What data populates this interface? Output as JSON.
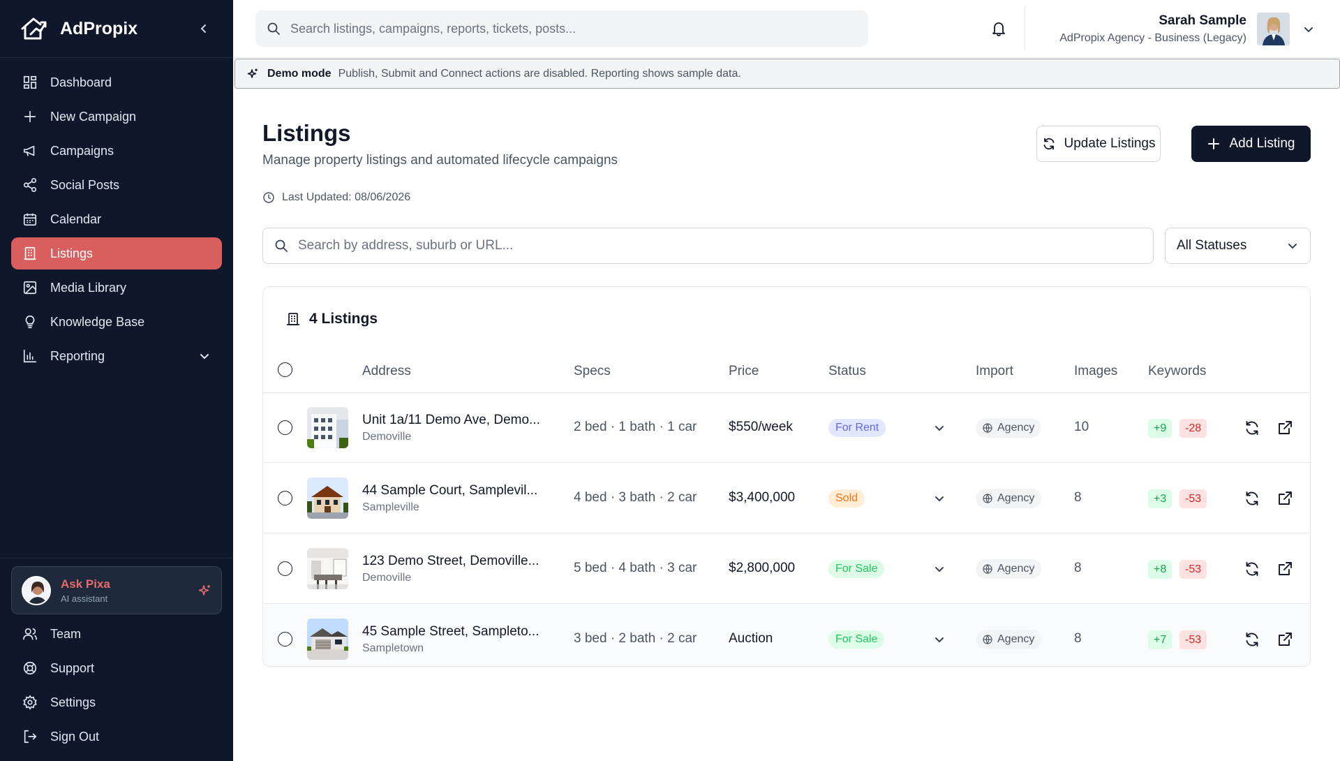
{
  "brand": {
    "name": "AdPropix"
  },
  "sidebar": {
    "items": [
      {
        "label": "Dashboard",
        "icon": "dashboard-icon"
      },
      {
        "label": "New Campaign",
        "icon": "plus-icon"
      },
      {
        "label": "Campaigns",
        "icon": "megaphone-icon"
      },
      {
        "label": "Social Posts",
        "icon": "share-icon"
      },
      {
        "label": "Calendar",
        "icon": "calendar-icon"
      },
      {
        "label": "Listings",
        "icon": "building-icon",
        "active": true
      },
      {
        "label": "Media Library",
        "icon": "image-icon"
      },
      {
        "label": "Knowledge Base",
        "icon": "lightbulb-icon"
      },
      {
        "label": "Reporting",
        "icon": "bar-chart-icon"
      }
    ],
    "assistant": {
      "title": "Ask Pixa",
      "subtitle": "AI assistant"
    },
    "bottom_items": [
      {
        "label": "Team",
        "icon": "users-icon"
      },
      {
        "label": "Support",
        "icon": "lifebuoy-icon"
      },
      {
        "label": "Settings",
        "icon": "gear-icon"
      },
      {
        "label": "Sign Out",
        "icon": "sign-out-icon"
      }
    ]
  },
  "topbar": {
    "search_placeholder": "Search listings, campaigns, reports, tickets, posts...",
    "user": {
      "name": "Sarah Sample",
      "org": "AdPropix Agency - Business (Legacy)"
    }
  },
  "demo_banner": {
    "title": "Demo mode",
    "text": "Publish, Submit and Connect actions are disabled. Reporting shows sample data."
  },
  "page": {
    "title": "Listings",
    "subtitle": "Manage property listings and automated lifecycle campaigns",
    "last_updated": "Last Updated: 08/06/2026",
    "update_button": "Update Listings",
    "add_button": "Add Listing",
    "search_placeholder": "Search by address, suburb or URL...",
    "status_filter": "All Statuses"
  },
  "table": {
    "title": "4 Listings",
    "columns": [
      "Address",
      "Specs",
      "Price",
      "Status",
      "Import",
      "Images",
      "Keywords"
    ],
    "rows": [
      {
        "address": "Unit 1a/11 Demo Ave, Demo...",
        "suburb": "Demoville",
        "specs": "2 bed · 1 bath · 1 car",
        "price": "$550/week",
        "status": "For Rent",
        "status_kind": "rent",
        "import": "Agency",
        "images": "10",
        "kw_pos": "+9",
        "kw_neg": "-28",
        "thumb": "apartment"
      },
      {
        "address": "44 Sample Court, Samplevil...",
        "suburb": "Sampleville",
        "specs": "4 bed · 3 bath · 2 car",
        "price": "$3,400,000",
        "status": "Sold",
        "status_kind": "sold",
        "import": "Agency",
        "images": "8",
        "kw_pos": "+3",
        "kw_neg": "-53",
        "thumb": "house"
      },
      {
        "address": "123 Demo Street, Demoville...",
        "suburb": "Demoville",
        "specs": "5 bed · 4 bath · 3 car",
        "price": "$2,800,000",
        "status": "For Sale",
        "status_kind": "sale",
        "import": "Agency",
        "images": "8",
        "kw_pos": "+8",
        "kw_neg": "-53",
        "thumb": "interior"
      },
      {
        "address": "45 Sample Street, Sampleto...",
        "suburb": "Sampletown",
        "specs": "3 bed · 2 bath · 2 car",
        "price": "Auction",
        "status": "For Sale",
        "status_kind": "sale",
        "import": "Agency",
        "images": "8",
        "kw_pos": "+7",
        "kw_neg": "-53",
        "thumb": "garage"
      }
    ]
  },
  "colors": {
    "sidebar_bg": "#0f172a",
    "accent": "#d95f5f",
    "primary_button": "#0f172a"
  }
}
